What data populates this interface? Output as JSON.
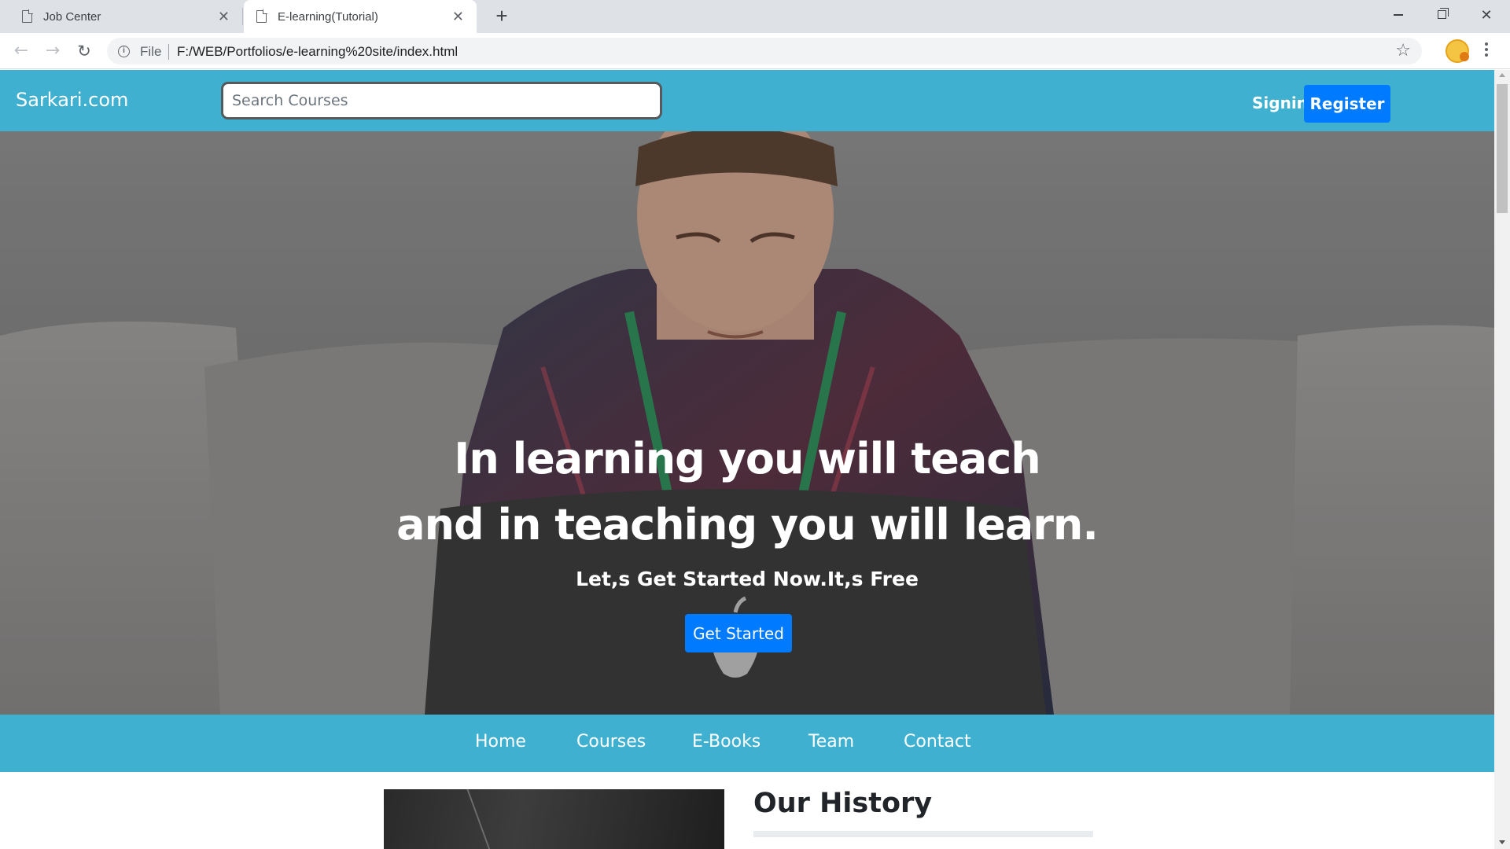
{
  "browser": {
    "tabs": [
      {
        "title": "Job Center",
        "active": false
      },
      {
        "title": "E-learning(Tutorial)",
        "active": true
      }
    ],
    "new_tab_symbol": "+",
    "url_scheme": "File",
    "url": "F:/WEB/Portfolios/e-learning%20site/index.html",
    "icons": {
      "back": "arrow-left-icon",
      "forward": "arrow-right-icon",
      "reload": "reload-icon",
      "info": "info-icon",
      "bookmark": "star-icon",
      "profile": "profile-icon",
      "menu": "kebab-menu-icon"
    }
  },
  "header": {
    "brand": "Sarkari.com",
    "search_placeholder": "Search Courses",
    "signin_label": "Signin",
    "register_label": "Register"
  },
  "hero": {
    "title_line1": "In learning you will teach",
    "title_line2": "and in teaching you will learn.",
    "subtitle": "Let,s Get Started Now.It,s Free",
    "cta_label": "Get Started"
  },
  "nav": {
    "items": [
      {
        "label": "Home"
      },
      {
        "label": "Courses"
      },
      {
        "label": "E-Books"
      },
      {
        "label": "Team"
      },
      {
        "label": "Contact"
      }
    ]
  },
  "history": {
    "title": "Our History"
  },
  "colors": {
    "accent": "#3fb0d0",
    "primary_button": "#007bff",
    "tabstrip": "#dee1e6"
  }
}
